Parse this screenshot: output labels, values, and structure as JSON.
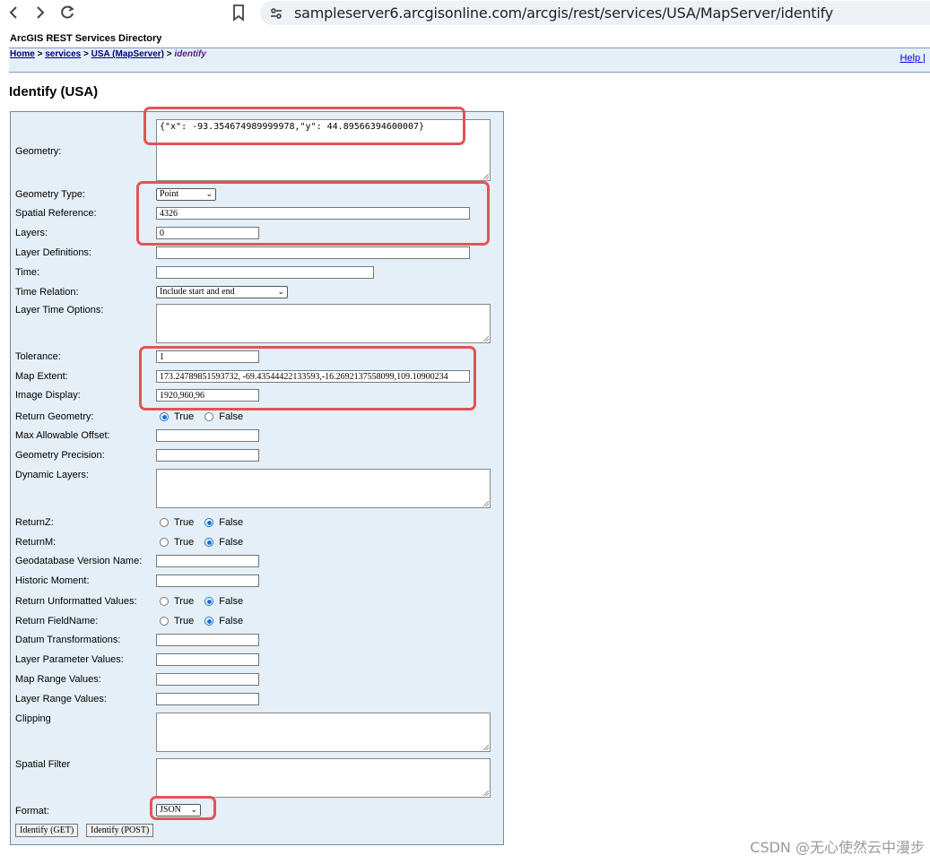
{
  "browser": {
    "url": "sampleserver6.arcgisonline.com/arcgis/rest/services/USA/MapServer/identify"
  },
  "header": {
    "directory_title": "ArcGIS REST Services Directory",
    "breadcrumb": {
      "home": "Home",
      "sep1": " > ",
      "services": "services",
      "sep2": " > ",
      "usa": "USA (MapServer)",
      "sep3": " > ",
      "identify": "identify"
    },
    "help": "Help |"
  },
  "page_title": "Identify (USA)",
  "form": {
    "geometry": {
      "label": "Geometry:",
      "value": "{\"x\": -93.354674989999978,\"y\": 44.89566394600007}"
    },
    "geometry_type": {
      "label": "Geometry Type:",
      "value": "Point"
    },
    "spatial_reference": {
      "label": "Spatial Reference:",
      "value": "4326"
    },
    "layers": {
      "label": "Layers:",
      "value": "0"
    },
    "layer_definitions": {
      "label": "Layer Definitions:",
      "value": ""
    },
    "time": {
      "label": "Time:",
      "value": ""
    },
    "time_relation": {
      "label": "Time Relation:",
      "value": "Include start and end"
    },
    "layer_time_options": {
      "label": "Layer Time Options:",
      "value": ""
    },
    "tolerance": {
      "label": "Tolerance:",
      "value": "1"
    },
    "map_extent": {
      "label": "Map Extent:",
      "value": "173.24789851593732, -69.43544422133593,-16.2692137558099,109.10900234"
    },
    "image_display": {
      "label": "Image Display:",
      "value": "1920,960,96"
    },
    "return_geometry": {
      "label": "Return Geometry:",
      "true_label": "True",
      "false_label": "False",
      "selected": "True"
    },
    "max_allowable_offset": {
      "label": "Max Allowable Offset:",
      "value": ""
    },
    "geometry_precision": {
      "label": "Geometry Precision:",
      "value": ""
    },
    "dynamic_layers": {
      "label": "Dynamic Layers:",
      "value": ""
    },
    "return_z": {
      "label": "ReturnZ:",
      "true_label": "True",
      "false_label": "False",
      "selected": "False"
    },
    "return_m": {
      "label": "ReturnM:",
      "true_label": "True",
      "false_label": "False",
      "selected": "False"
    },
    "gdb_version": {
      "label": "Geodatabase Version Name:",
      "value": ""
    },
    "historic_moment": {
      "label": "Historic Moment:",
      "value": ""
    },
    "return_unformatted": {
      "label": "Return Unformatted Values:",
      "true_label": "True",
      "false_label": "False",
      "selected": "False"
    },
    "return_fieldname": {
      "label": "Return FieldName:",
      "true_label": "True",
      "false_label": "False",
      "selected": "False"
    },
    "datum_transformations": {
      "label": "Datum Transformations:",
      "value": ""
    },
    "layer_parameter_values": {
      "label": "Layer Parameter Values:",
      "value": ""
    },
    "map_range_values": {
      "label": "Map Range Values:",
      "value": ""
    },
    "layer_range_values": {
      "label": "Layer Range Values:",
      "value": ""
    },
    "clipping": {
      "label": "Clipping",
      "value": ""
    },
    "spatial_filter": {
      "label": "Spatial Filter",
      "value": ""
    },
    "format": {
      "label": "Format:",
      "value": "JSON"
    },
    "buttons": {
      "get": "Identify (GET)",
      "post": "Identify (POST)"
    }
  },
  "watermark": "CSDN @无心使然云中漫步",
  "colors": {
    "highlight": "#e25454",
    "panel_bg": "#e5eff7",
    "link": "#000080",
    "radio_selected": "#1a6fd1"
  }
}
